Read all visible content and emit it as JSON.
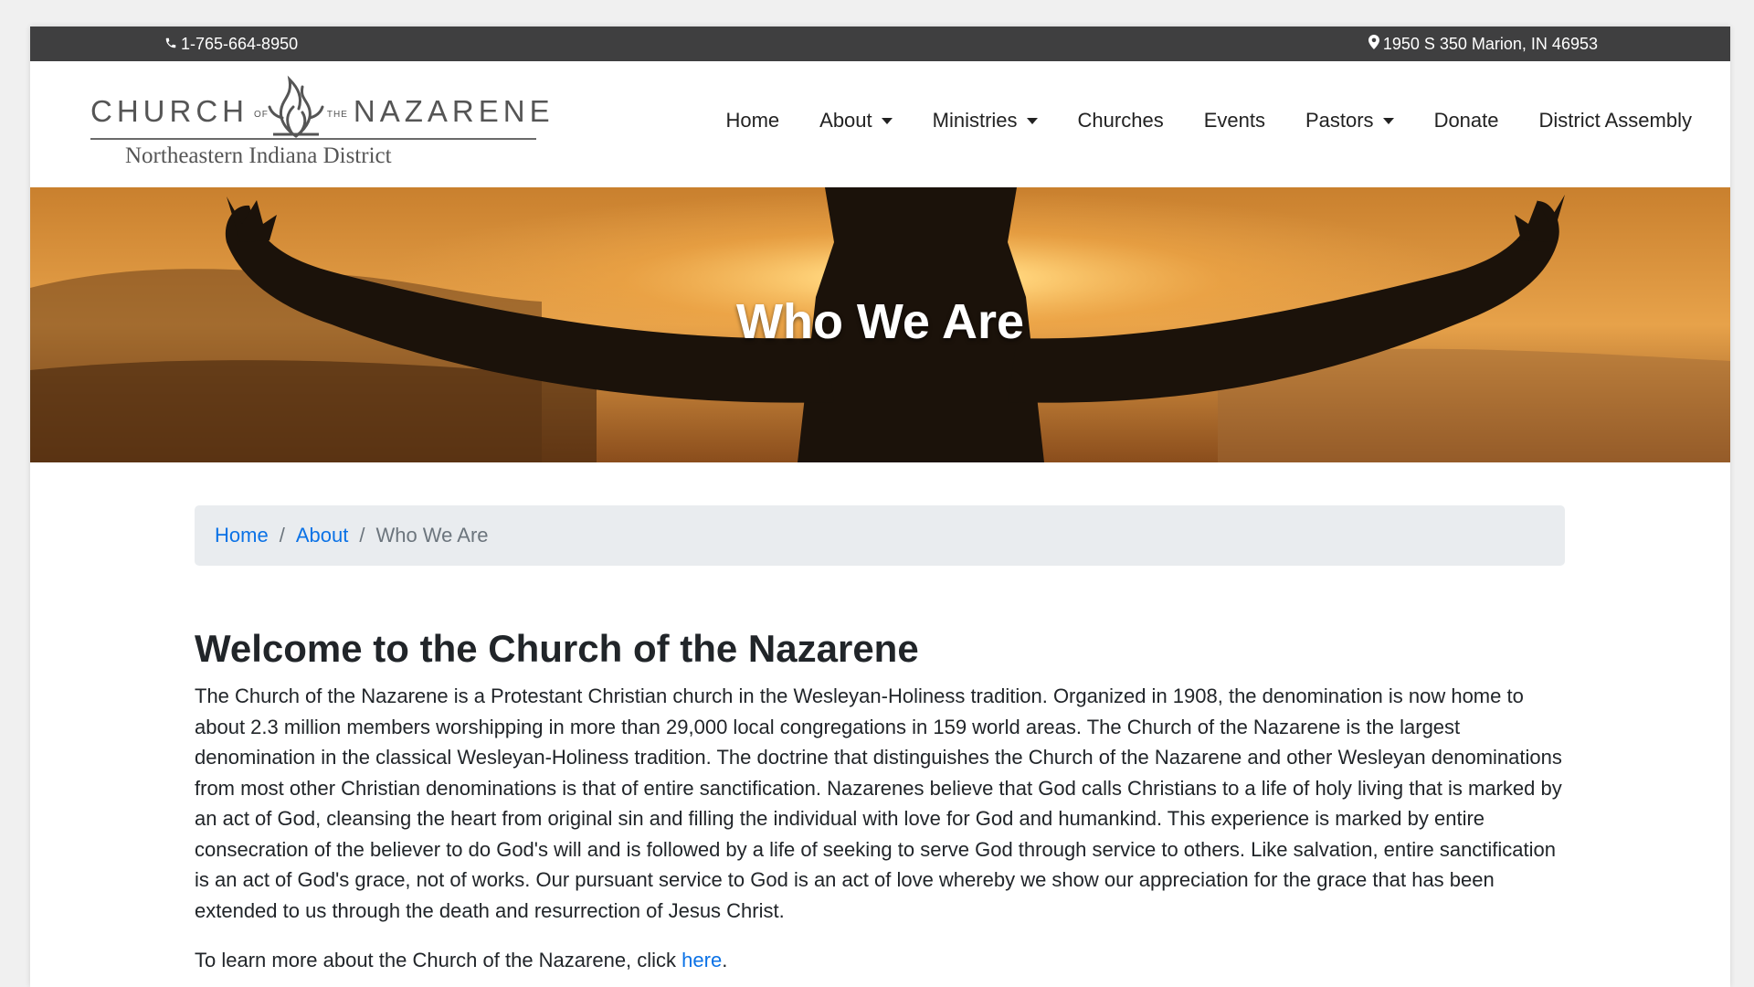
{
  "topbar": {
    "phone": "1-765-664-8950",
    "address": "1950 S 350 Marion, IN 46953",
    "phone_icon": "phone-icon",
    "address_icon": "map-marker-icon"
  },
  "logo": {
    "word1": "CHURCH",
    "word_of": "OF",
    "word_the": "THE",
    "word2": "NAZARENE",
    "subtitle": "Northeastern Indiana District"
  },
  "nav": {
    "items": [
      {
        "label": "Home",
        "dropdown": false
      },
      {
        "label": "About",
        "dropdown": true
      },
      {
        "label": "Ministries",
        "dropdown": true
      },
      {
        "label": "Churches",
        "dropdown": false
      },
      {
        "label": "Events",
        "dropdown": false
      },
      {
        "label": "Pastors",
        "dropdown": true
      },
      {
        "label": "Donate",
        "dropdown": false
      },
      {
        "label": "District Assembly",
        "dropdown": false
      }
    ]
  },
  "hero": {
    "title": "Who We Are"
  },
  "breadcrumb": {
    "home": "Home",
    "about": "About",
    "current": "Who We Are",
    "separator": "/"
  },
  "content": {
    "heading": "Welcome to the Church of the Nazarene",
    "body": "The Church of the Nazarene is a Protestant Christian church in the Wesleyan-Holiness tradition. Organized in 1908, the denomination is now home to about 2.3 million members worshipping in more than 29,000 local congregations in 159 world areas. The Church of the Nazarene is the largest denomination in the classical Wesleyan-Holiness tradition. The doctrine that distinguishes the Church of the Nazarene and other Wesleyan denominations from most other Christian denominations is that of entire sanctification. Nazarenes believe that God calls Christians to a life of holy living that is marked by an act of God, cleansing the heart from original sin and filling the individual with love for God and humankind. This experience is marked by entire consecration of the believer to do God's will and is followed by a life of seeking to serve God through service to others. Like salvation, entire sanctification is an act of God's grace, not of works. Our pursuant service to God is an act of love whereby we show our appreciation for the grace that has been extended to us through the death and resurrection of Jesus Christ.",
    "more_prefix": "To learn more about the Church of the Nazarene, click ",
    "more_link": "here",
    "more_suffix": "."
  },
  "colors": {
    "topbar_bg": "#3f3f40",
    "link": "#0b72e6",
    "breadcrumb_bg": "#e9ecef",
    "text": "#212529"
  }
}
